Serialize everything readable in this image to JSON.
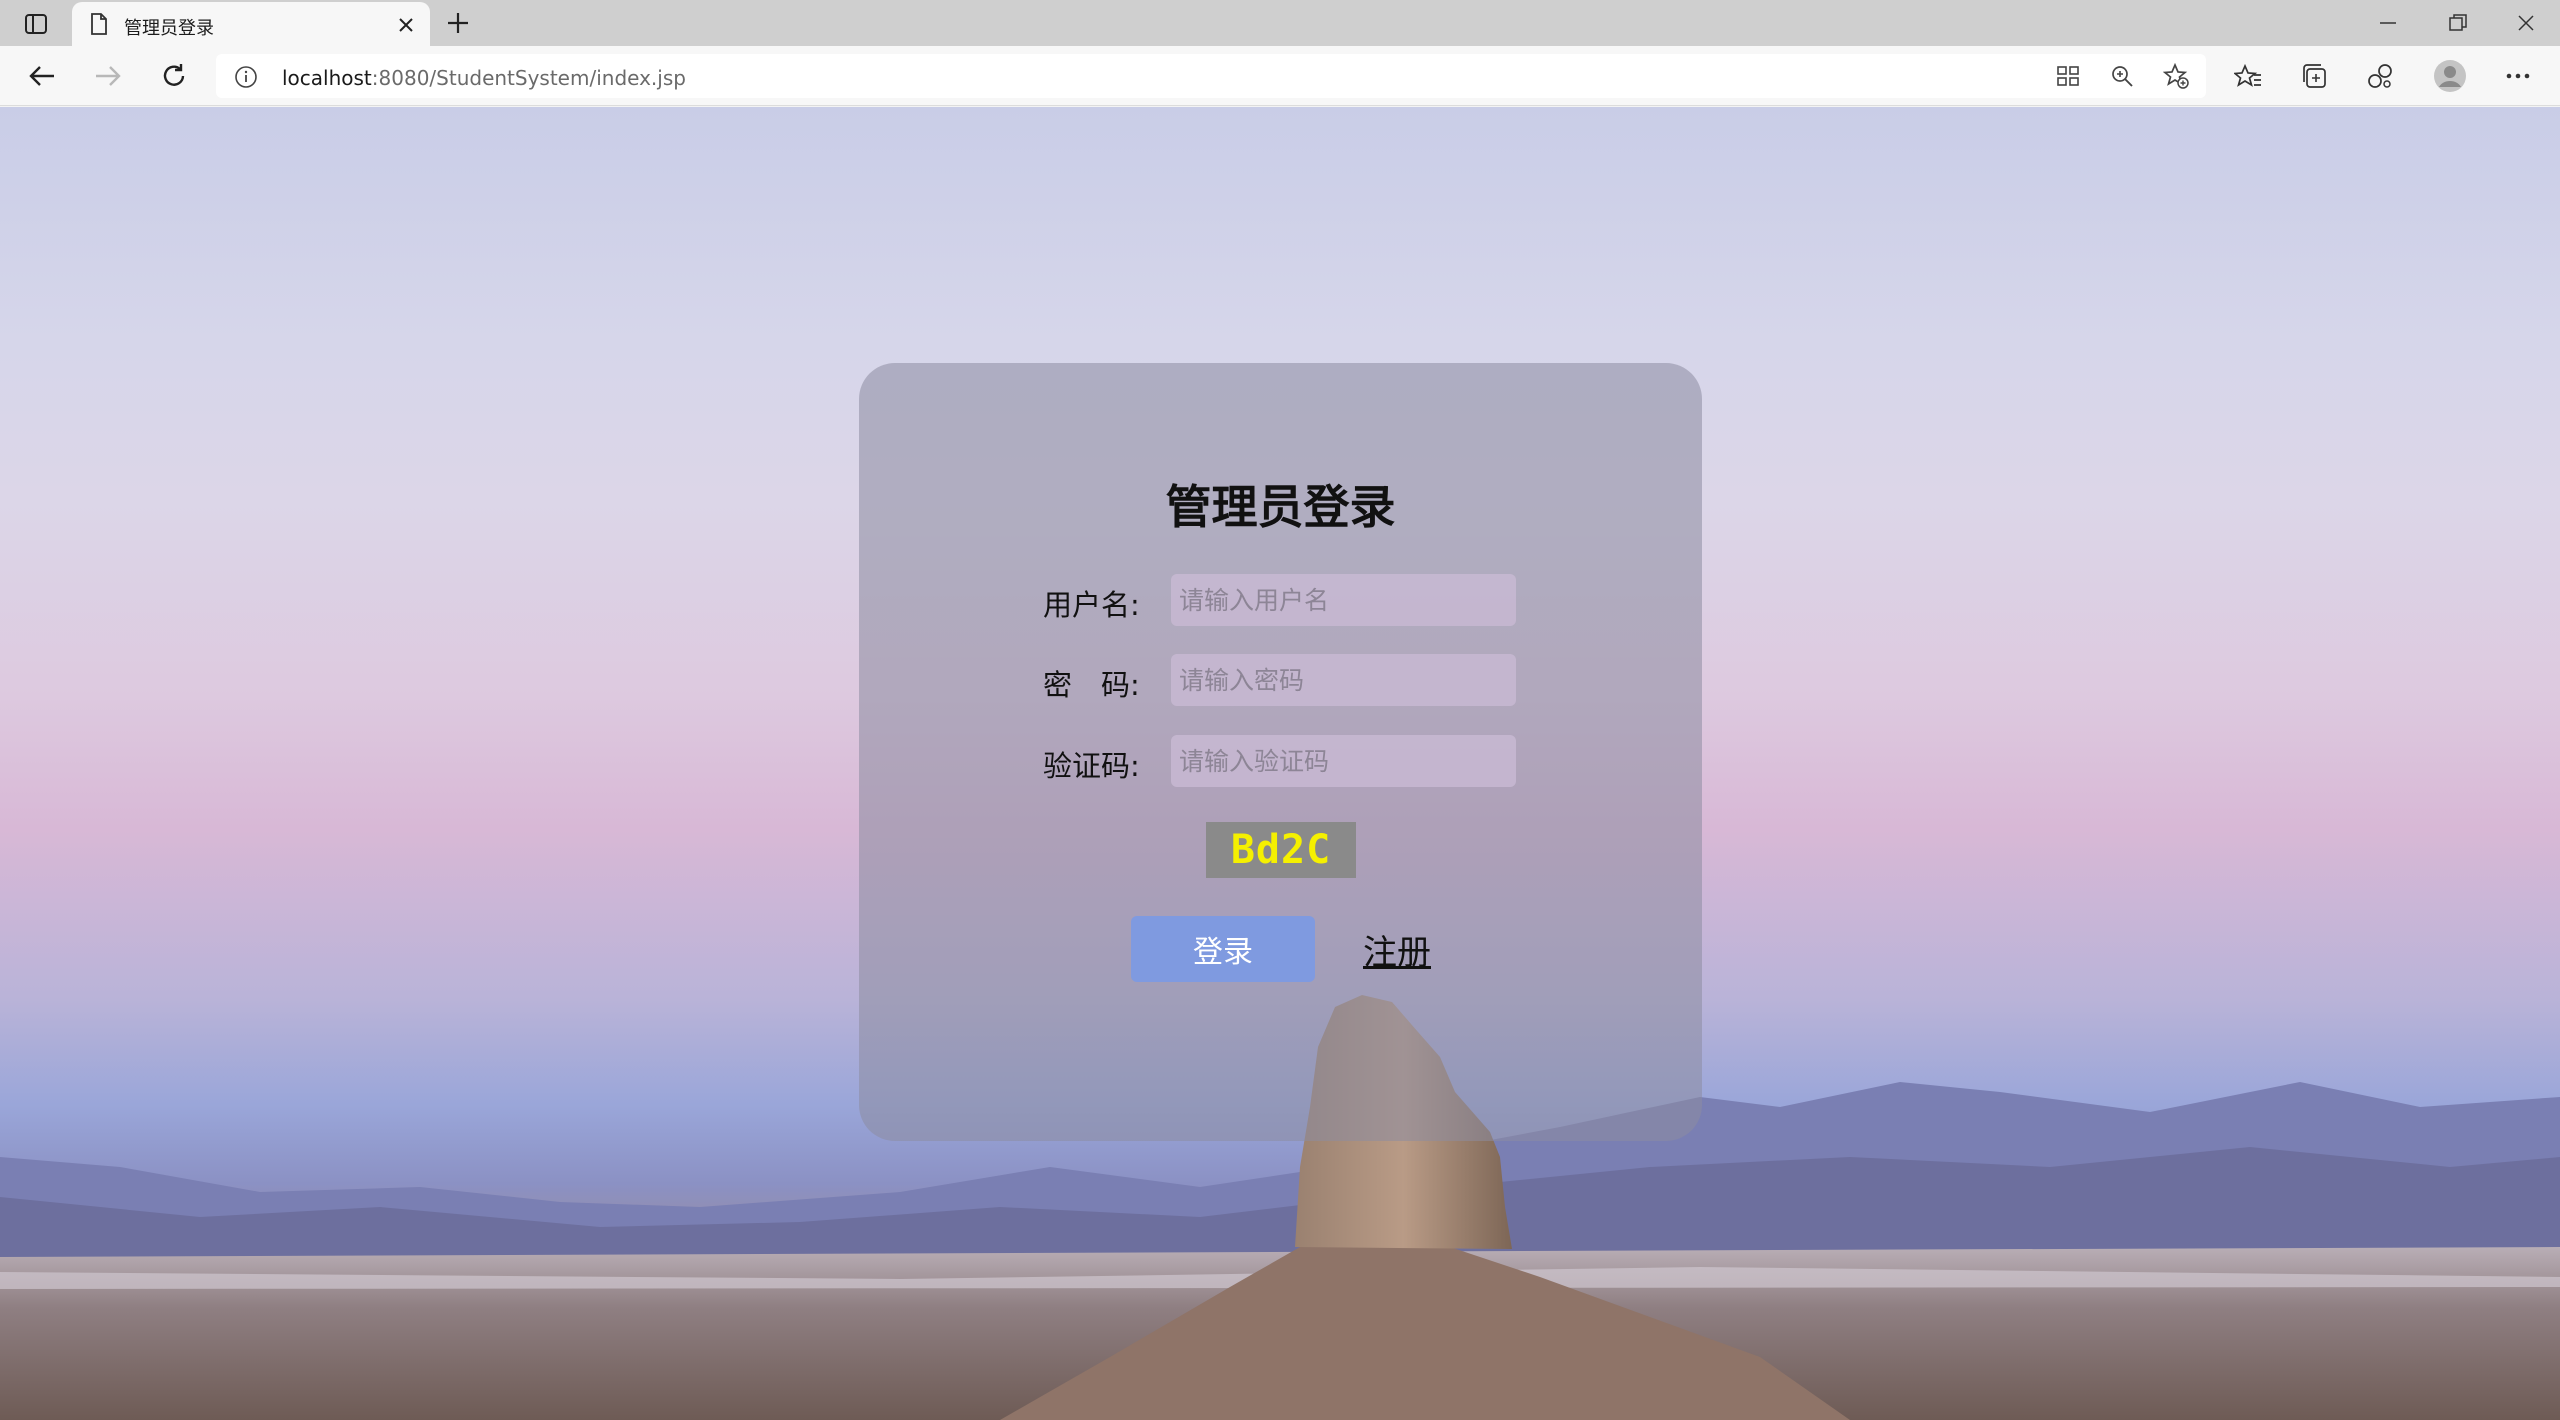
{
  "browser": {
    "tab_title": "管理员登录",
    "url_host": "localhost",
    "url_rest": ":8080/StudentSystem/index.jsp"
  },
  "login": {
    "title": "管理员登录",
    "username_label": "用户名:",
    "username_placeholder": "请输入用户名",
    "password_label": "密　码:",
    "password_placeholder": "请输入密码",
    "captcha_label": "验证码:",
    "captcha_placeholder": "请输入验证码",
    "captcha_code": "Bd2C",
    "login_button": "登录",
    "register_link": "注册"
  },
  "colors": {
    "card_bg": "#8c8ca0",
    "login_button_bg": "#7f9ae0",
    "captcha_bg": "#8a8a8a",
    "captcha_text": "#f5f000"
  },
  "icons": [
    "tab-actions-icon",
    "page-icon",
    "close-icon",
    "plus-icon",
    "minimize-icon",
    "restore-icon",
    "close-window-icon",
    "back-icon",
    "forward-icon",
    "refresh-icon",
    "info-icon",
    "app-grid-icon",
    "zoom-icon",
    "add-favorite-icon",
    "favorites-icon",
    "collections-icon",
    "extensions-icon",
    "profile-icon",
    "more-icon"
  ]
}
